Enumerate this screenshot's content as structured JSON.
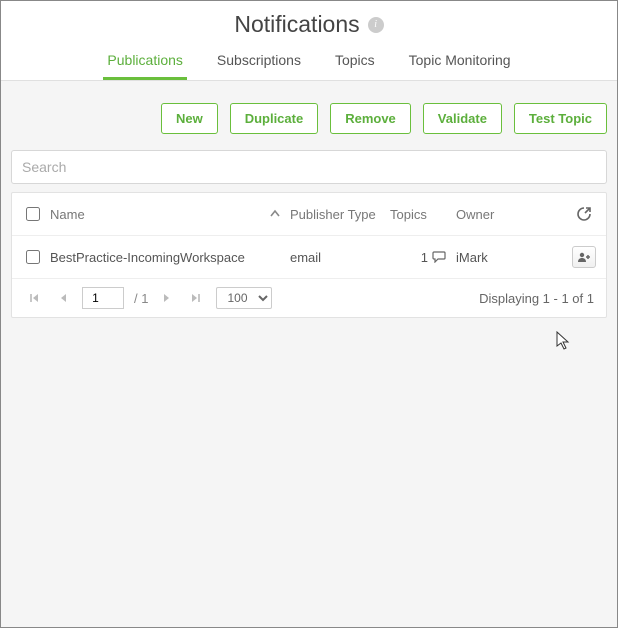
{
  "header": {
    "title": "Notifications"
  },
  "tabs": [
    {
      "label": "Publications",
      "active": true
    },
    {
      "label": "Subscriptions",
      "active": false
    },
    {
      "label": "Topics",
      "active": false
    },
    {
      "label": "Topic Monitoring",
      "active": false
    }
  ],
  "toolbar": {
    "new": "New",
    "duplicate": "Duplicate",
    "remove": "Remove",
    "validate": "Validate",
    "test_topic": "Test Topic"
  },
  "search": {
    "placeholder": "Search",
    "value": ""
  },
  "grid": {
    "columns": {
      "name": "Name",
      "publisher_type": "Publisher Type",
      "topics": "Topics",
      "owner": "Owner"
    },
    "rows": [
      {
        "name": "BestPractice-IncomingWorkspace",
        "publisher_type": "email",
        "topics_count": "1",
        "owner": "iMark"
      }
    ]
  },
  "pager": {
    "page": "1",
    "total_pages_label": "/ 1",
    "page_size": "100",
    "display": "Displaying 1 - 1 of 1"
  }
}
